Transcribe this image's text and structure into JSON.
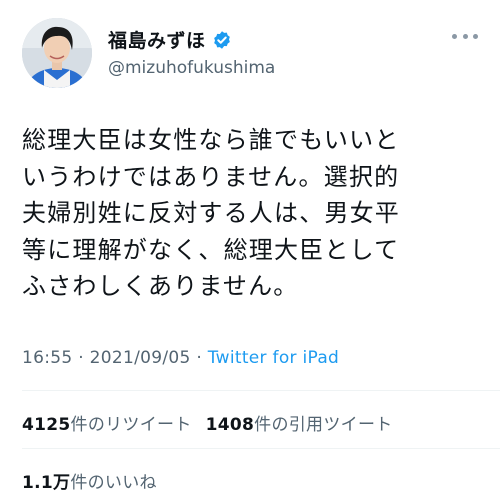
{
  "author": {
    "display_name": "福島みずほ",
    "handle": "@mizuhofukushima",
    "verified": true
  },
  "tweet": {
    "lines": [
      "総理大臣は女性なら誰でもいいと",
      "いうわけではありません。選択的",
      "夫婦別姓に反対する人は、男女平",
      "等に理解がなく、総理大臣として",
      "ふさわしくありません。"
    ],
    "time": "16:55",
    "date": "2021/09/05",
    "separator": "·",
    "source": "Twitter for iPad"
  },
  "stats": {
    "retweets_count": "4125",
    "retweets_label": "件のリツイート",
    "quotes_count": "1408",
    "quotes_label": "件の引用ツイート",
    "likes_count": "1.1万",
    "likes_label": "件のいいね"
  },
  "colors": {
    "verified_badge": "#1d9bf0",
    "link": "#1d9bf0",
    "secondary_text": "#536471"
  }
}
